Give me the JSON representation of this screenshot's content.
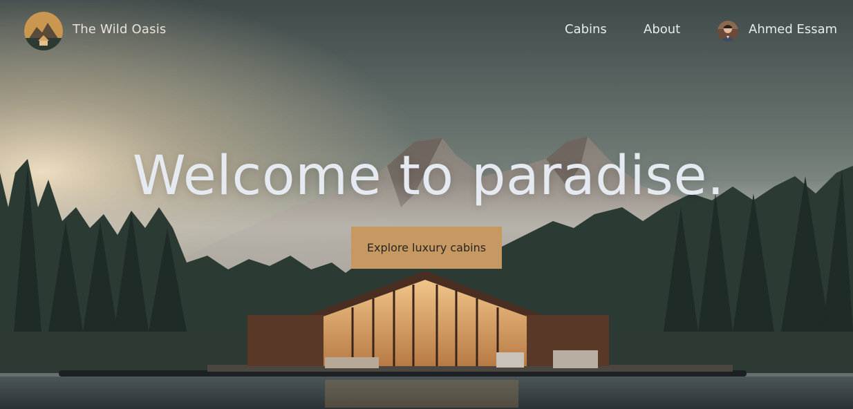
{
  "header": {
    "brand_name": "The Wild Oasis",
    "nav_items": [
      {
        "label": "Cabins"
      },
      {
        "label": "About"
      }
    ],
    "user": {
      "name": "Ahmed Essam"
    }
  },
  "hero": {
    "headline": "Welcome to paradise.",
    "cta_label": "Explore luxury cabins"
  },
  "colors": {
    "accent": "#c69963",
    "text_light": "#e5e9f0",
    "sky_top": "#4a5654",
    "sunlight": "#d9c8ae"
  },
  "icons": [
    "wild-oasis-logo",
    "user-avatar"
  ]
}
